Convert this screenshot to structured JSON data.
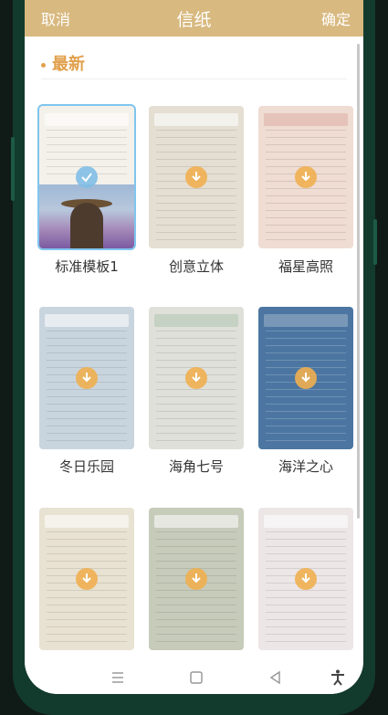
{
  "header": {
    "cancel": "取消",
    "title": "信纸",
    "confirm": "确定"
  },
  "section": {
    "title": "最新"
  },
  "templates": [
    {
      "name": "标准模板1",
      "colors": [
        "#f4f1ea",
        "#ffffff"
      ],
      "selected": true
    },
    {
      "name": "创意立体",
      "colors": [
        "#e4dfd2",
        "#f0ebdd"
      ]
    },
    {
      "name": "福星高照",
      "colors": [
        "#efdcd2",
        "#f6e9e1"
      ]
    },
    {
      "name": "冬日乐园",
      "colors": [
        "#c9d5de",
        "#dfe5e8"
      ]
    },
    {
      "name": "海角七号",
      "colors": [
        "#dfe0da",
        "#ebebe6"
      ]
    },
    {
      "name": "海洋之心",
      "colors": [
        "#4c76a1",
        "#5e89b3"
      ]
    },
    {
      "name": "",
      "colors": [
        "#e8e2d2",
        "#efeadf"
      ]
    },
    {
      "name": "",
      "colors": [
        "#c6cbba",
        "#d5d8c8"
      ]
    },
    {
      "name": "",
      "colors": [
        "#ece6e6",
        "#f4efee"
      ]
    }
  ],
  "navbar": {
    "icons": [
      "menu-icon",
      "home-icon",
      "back-icon",
      "accessibility-icon"
    ]
  },
  "colors": {
    "accent": "#d8b97f",
    "section": "#e1a04c",
    "selection": "#7fc6ef"
  }
}
